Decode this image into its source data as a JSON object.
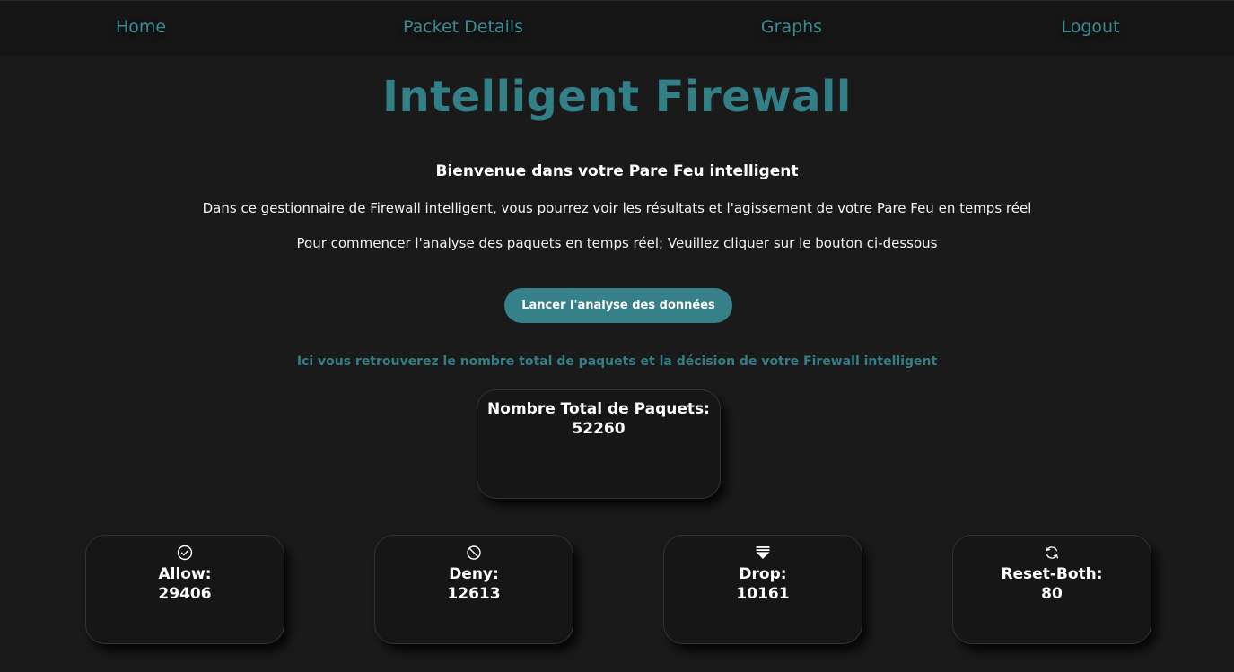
{
  "nav": {
    "home": "Home",
    "packet_details": "Packet Details",
    "graphs": "Graphs",
    "logout": "Logout"
  },
  "header": {
    "title": "Intelligent Firewall"
  },
  "intro": {
    "welcome": "Bienvenue dans votre Pare Feu intelligent",
    "line1": "Dans ce gestionnaire de Firewall intelligent, vous pourrez voir les résultats et l'agissement de votre Pare Feu en temps réel",
    "line2": "Pour commencer l'analyse des paquets en temps réel; Veuillez cliquer sur le bouton ci-dessous"
  },
  "launch_button": "Lancer l'analyse des données",
  "info_text": "Ici vous retrouverez le nombre total de paquets et la décision de votre Firewall intelligent",
  "total": {
    "label": "Nombre Total de Paquets:",
    "value": "52260"
  },
  "actions": [
    {
      "label": "Allow:",
      "value": "29406",
      "icon": "check-circle-icon"
    },
    {
      "label": "Deny:",
      "value": "12613",
      "icon": "ban-icon"
    },
    {
      "label": "Drop:",
      "value": "10161",
      "icon": "drop-down-icon"
    },
    {
      "label": "Reset-Both:",
      "value": "80",
      "icon": "refresh-icon"
    }
  ],
  "colors": {
    "accent": "#327f87",
    "button": "#36808a",
    "background": "#1a1a1a",
    "card": "#161616"
  }
}
